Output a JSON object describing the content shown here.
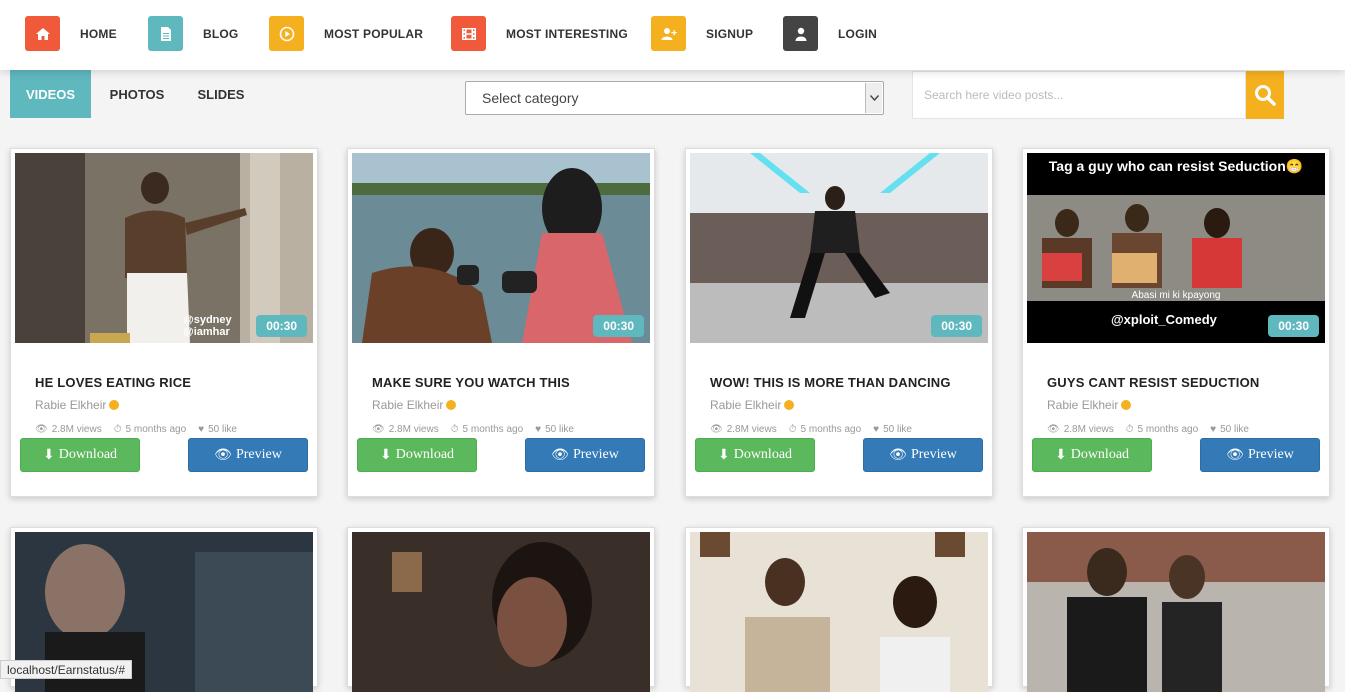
{
  "nav": [
    {
      "label": "HOME",
      "icon": "home-icon",
      "color": "#f0593a"
    },
    {
      "label": "BLOG",
      "icon": "document-icon",
      "color": "#5fb8be"
    },
    {
      "label": "MOST POPULAR",
      "icon": "play-circle-icon",
      "color": "#f4b01f"
    },
    {
      "label": "MOST INTERESTING",
      "icon": "film-icon",
      "color": "#f0593a"
    },
    {
      "label": "SIGNUP",
      "icon": "user-plus-icon",
      "color": "#f4b01f"
    },
    {
      "label": "LOGIN",
      "icon": "user-icon",
      "color": "#444444"
    }
  ],
  "tabs": [
    {
      "label": "VIDEOS",
      "active": true
    },
    {
      "label": "PHOTOS",
      "active": false
    },
    {
      "label": "SLIDES",
      "active": false
    }
  ],
  "category_select": {
    "value": "Select category"
  },
  "search": {
    "placeholder": "Search here video posts..."
  },
  "cards": [
    {
      "title": "HE LOVES EATING RICE",
      "author": "Rabie Elkheir",
      "views": "2.8M views",
      "time": "5 months ago",
      "likes": "50 like",
      "duration": "00:30",
      "download": "Download",
      "preview": "Preview"
    },
    {
      "title": "MAKE SURE YOU WATCH THIS",
      "author": "Rabie Elkheir",
      "views": "2.8M views",
      "time": "5 months ago",
      "likes": "50 like",
      "duration": "00:30",
      "download": "Download",
      "preview": "Preview"
    },
    {
      "title": "WOW! THIS IS MORE THAN DANCING",
      "author": "Rabie Elkheir",
      "views": "2.8M views",
      "time": "5 months ago",
      "likes": "50 like",
      "duration": "00:30",
      "download": "Download",
      "preview": "Preview"
    },
    {
      "title": "GUYS CANT RESIST SEDUCTION",
      "author": "Rabie Elkheir",
      "views": "2.8M views",
      "time": "5 months ago",
      "likes": "50 like",
      "duration": "00:30",
      "download": "Download",
      "preview": "Preview"
    }
  ],
  "thumb_captions": {
    "card1": "@sydney\n@iamhar",
    "card4_top": "Tag a guy who can resist Seduction😁",
    "card4_mid": "Abasi mi ki kpayong",
    "card4_bottom": "@xploit_Comedy"
  },
  "status_url": "localhost/Earnstatus/#"
}
